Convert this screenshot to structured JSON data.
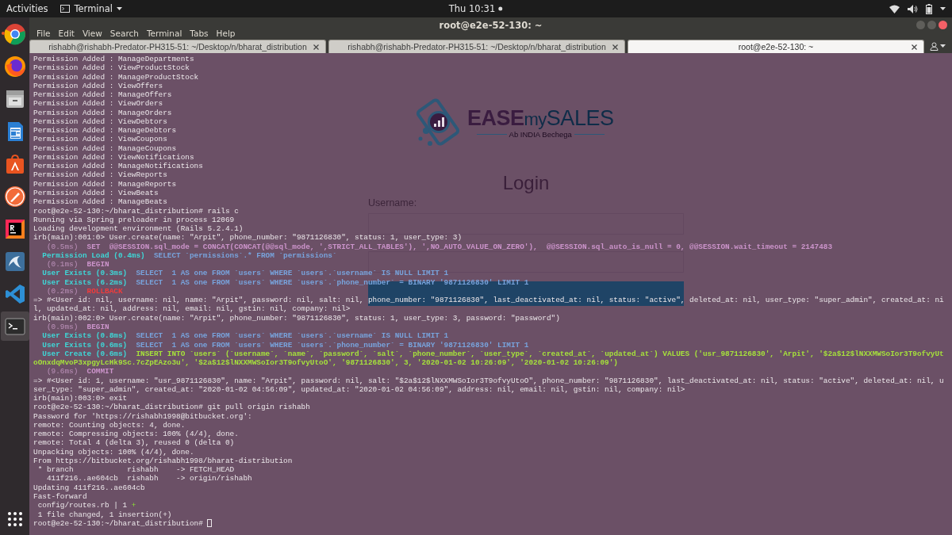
{
  "top_bar": {
    "activities": "Activities",
    "app_menu": "Terminal",
    "clock": "Thu 10:31"
  },
  "dock": [
    {
      "kind": "chrome",
      "running": true,
      "selected": false
    },
    {
      "kind": "firefox",
      "running": false,
      "selected": false
    },
    {
      "kind": "files",
      "running": false,
      "selected": false
    },
    {
      "kind": "writer",
      "running": false,
      "selected": false
    },
    {
      "kind": "software",
      "running": false,
      "selected": false
    },
    {
      "kind": "postman",
      "running": false,
      "selected": false
    },
    {
      "kind": "rubymine",
      "running": false,
      "selected": false
    },
    {
      "kind": "workbench",
      "running": false,
      "selected": false
    },
    {
      "kind": "vscode",
      "running": false,
      "selected": false
    },
    {
      "kind": "terminal",
      "running": false,
      "selected": true
    }
  ],
  "window": {
    "title": "root@e2e-52-130: ~",
    "menu": [
      "File",
      "Edit",
      "View",
      "Search",
      "Terminal",
      "Tabs",
      "Help"
    ],
    "tabs": [
      {
        "label": "rishabh@rishabh-Predator-PH315-51: ~/Desktop/n/bharat_distribution",
        "selected": false
      },
      {
        "label": "rishabh@rishabh-Predator-PH315-51: ~/Desktop/n/bharat_distribution",
        "selected": false
      },
      {
        "label": "root@e2e-52-130: ~",
        "selected": true
      }
    ]
  },
  "web_page": {
    "logo": {
      "part_1": "EASE",
      "part_2": "my",
      "part_3": "SALES",
      "tagline": "Ab INDIA Bechega"
    },
    "heading": "Login",
    "username_label": "Username:"
  },
  "terminal_lines": [
    {
      "spans": [
        {
          "kind": "plain",
          "text": "Permission Added : ManageDepartments"
        }
      ]
    },
    {
      "spans": [
        {
          "kind": "plain",
          "text": "Permission Added : ViewProductStock"
        }
      ]
    },
    {
      "spans": [
        {
          "kind": "plain",
          "text": "Permission Added : ManageProductStock"
        }
      ]
    },
    {
      "spans": [
        {
          "kind": "plain",
          "text": "Permission Added : ViewOffers"
        }
      ]
    },
    {
      "spans": [
        {
          "kind": "plain",
          "text": "Permission Added : ManageOffers"
        }
      ]
    },
    {
      "spans": [
        {
          "kind": "plain",
          "text": "Permission Added : ViewOrders"
        }
      ]
    },
    {
      "spans": [
        {
          "kind": "plain",
          "text": "Permission Added : ManageOrders"
        }
      ]
    },
    {
      "spans": [
        {
          "kind": "plain",
          "text": "Permission Added : ViewDebtors"
        }
      ]
    },
    {
      "spans": [
        {
          "kind": "plain",
          "text": "Permission Added : ManageDebtors"
        }
      ]
    },
    {
      "spans": [
        {
          "kind": "plain",
          "text": "Permission Added : ViewCoupons"
        }
      ]
    },
    {
      "spans": [
        {
          "kind": "plain",
          "text": "Permission Added : ManageCoupons"
        }
      ]
    },
    {
      "spans": [
        {
          "kind": "plain",
          "text": "Permission Added : ViewNotifications"
        }
      ]
    },
    {
      "spans": [
        {
          "kind": "plain",
          "text": "Permission Added : ManageNotifications"
        }
      ]
    },
    {
      "spans": [
        {
          "kind": "plain",
          "text": "Permission Added : ViewReports"
        }
      ]
    },
    {
      "spans": [
        {
          "kind": "plain",
          "text": "Permission Added : ManageReports"
        }
      ]
    },
    {
      "spans": [
        {
          "kind": "plain",
          "text": "Permission Added : ViewBeats"
        }
      ]
    },
    {
      "spans": [
        {
          "kind": "plain",
          "text": "Permission Added : ManageBeats"
        }
      ]
    },
    {
      "spans": [
        {
          "kind": "plain",
          "text": "root@e2e-52-130:~/bharat_distribution# rails c"
        }
      ]
    },
    {
      "spans": [
        {
          "kind": "plain",
          "text": "Running via Spring preloader in process 12069"
        }
      ]
    },
    {
      "spans": [
        {
          "kind": "plain",
          "text": "Loading development environment (Rails 5.2.4.1)"
        }
      ]
    },
    {
      "spans": [
        {
          "kind": "plain",
          "text": "irb(main):001:0> User.create(name: \"Arpit\", phone_number: \"9871126830\", status: 1, user_type: 3)"
        }
      ]
    },
    {
      "spans": [
        {
          "kind": "timing",
          "text": "   (0.5ms)"
        },
        {
          "kind": "tx",
          "text": "  SET  @@SESSION.sql_mode = CONCAT(CONCAT(@@sql_mode, ',STRICT_ALL_TABLES'), ',NO_AUTO_VALUE_ON_ZERO'),  @@SESSION.sql_auto_is_null = 0, @@SESSION.wait_timeout = 2147483"
        }
      ]
    },
    {
      "spans": [
        {
          "kind": "label",
          "text": "  Permission Load (0.4ms)"
        },
        {
          "kind": "sql",
          "text": "  SELECT `permissions`.* FROM `permissions`"
        }
      ]
    },
    {
      "spans": [
        {
          "kind": "timing",
          "text": "   (0.1ms)"
        },
        {
          "kind": "tx",
          "text": "  BEGIN"
        }
      ]
    },
    {
      "spans": [
        {
          "kind": "label",
          "text": "  User Exists (0.3ms)"
        },
        {
          "kind": "sql",
          "text": "  SELECT  1 AS one FROM `users` WHERE `users`.`username` IS NULL LIMIT 1"
        }
      ]
    },
    {
      "spans": [
        {
          "kind": "label",
          "text": "  User Exists (6.2ms)"
        },
        {
          "kind": "sql",
          "text": "  SELECT  1 AS one FROM `users` WHERE `users`.`phone_number` = BINARY '9871126830' LIMIT 1"
        }
      ]
    },
    {
      "spans": [
        {
          "kind": "timing",
          "text": "   (0.2ms)"
        },
        {
          "kind": "error",
          "text": "  ROLLBACK"
        }
      ]
    },
    {
      "spans": [
        {
          "kind": "plain",
          "text": "=> #<User id: nil, username: nil, name: \"Arpit\", password: nil, salt: nil, phone_number: \"9871126830\", last_deactivated_at: nil, status: \"active\", deleted_at: nil, user_type: \"super_admin\", created_at: ni"
        }
      ]
    },
    {
      "spans": [
        {
          "kind": "plain",
          "text": "l, updated_at: nil, address: nil, email: nil, gstin: nil, company: nil>"
        }
      ]
    },
    {
      "spans": [
        {
          "kind": "plain",
          "text": "irb(main):002:0> User.create(name: \"Arpit\", phone_number: \"9871126830\", status: 1, user_type: 3, password: \"password\")"
        }
      ]
    },
    {
      "spans": [
        {
          "kind": "timing",
          "text": "   (0.9ms)"
        },
        {
          "kind": "tx",
          "text": "  BEGIN"
        }
      ]
    },
    {
      "spans": [
        {
          "kind": "label",
          "text": "  User Exists (0.8ms)"
        },
        {
          "kind": "sql",
          "text": "  SELECT  1 AS one FROM `users` WHERE `users`.`username` IS NULL LIMIT 1"
        }
      ]
    },
    {
      "spans": [
        {
          "kind": "label",
          "text": "  User Exists (0.6ms)"
        },
        {
          "kind": "sql",
          "text": "  SELECT  1 AS one FROM `users` WHERE `users`.`phone_number` = BINARY '9871126830' LIMIT 1"
        }
      ]
    },
    {
      "spans": [
        {
          "kind": "label",
          "text": "  User Create (0.6ms)"
        },
        {
          "kind": "insert",
          "text": "  INSERT INTO `users` (`username`, `name`, `password`, `salt`, `phone_number`, `user_type`, `created_at`, `updated_at`) VALUES ('usr_9871126830', 'Arpit', '$2a$12$lNXXMWSoIor3T9ofvyUt"
        }
      ]
    },
    {
      "spans": [
        {
          "kind": "insert",
          "text": "oOnxdqMvoP3xpgyLcHk9Sc.7cZpEAzo3u', '$2a$12$lNXXMWSoIor3T9ofvyUtoO', '9871126830', 3, '2020-01-02 10:26:09', '2020-01-02 10:26:09')"
        }
      ]
    },
    {
      "spans": [
        {
          "kind": "timing",
          "text": "   (9.6ms)"
        },
        {
          "kind": "tx",
          "text": "  COMMIT"
        }
      ]
    },
    {
      "spans": [
        {
          "kind": "plain",
          "text": "=> #<User id: 1, username: \"usr_9871126830\", name: \"Arpit\", password: nil, salt: \"$2a$12$lNXXMWSoIor3T9ofvyUtoO\", phone_number: \"9871126830\", last_deactivated_at: nil, status: \"active\", deleted_at: nil, u"
        }
      ]
    },
    {
      "spans": [
        {
          "kind": "plain",
          "text": "ser_type: \"super_admin\", created_at: \"2020-01-02 04:56:09\", updated_at: \"2020-01-02 04:56:09\", address: nil, email: nil, gstin: nil, company: nil>"
        }
      ]
    },
    {
      "spans": [
        {
          "kind": "plain",
          "text": "irb(main):003:0> exit"
        }
      ]
    },
    {
      "spans": [
        {
          "kind": "plain",
          "text": "root@e2e-52-130:~/bharat_distribution# git pull origin rishabh"
        }
      ]
    },
    {
      "spans": [
        {
          "kind": "plain",
          "text": "Password for 'https://rishabh1998@bitbucket.org':"
        }
      ]
    },
    {
      "spans": [
        {
          "kind": "plain",
          "text": "remote: Counting objects: 4, done."
        }
      ]
    },
    {
      "spans": [
        {
          "kind": "plain",
          "text": "remote: Compressing objects: 100% (4/4), done."
        }
      ]
    },
    {
      "spans": [
        {
          "kind": "plain",
          "text": "remote: Total 4 (delta 3), reused 0 (delta 0)"
        }
      ]
    },
    {
      "spans": [
        {
          "kind": "plain",
          "text": "Unpacking objects: 100% (4/4), done."
        }
      ]
    },
    {
      "spans": [
        {
          "kind": "plain",
          "text": "From https://bitbucket.org/rishabh1998/bharat-distribution"
        }
      ]
    },
    {
      "spans": [
        {
          "kind": "plain",
          "text": " * branch            rishabh    -> FETCH_HEAD"
        }
      ]
    },
    {
      "spans": [
        {
          "kind": "plain",
          "text": "   411f216..ae604cb  rishabh    -> origin/rishabh"
        }
      ]
    },
    {
      "spans": [
        {
          "kind": "plain",
          "text": "Updating 411f216..ae604cb"
        }
      ]
    },
    {
      "spans": [
        {
          "kind": "plain",
          "text": "Fast-forward"
        }
      ]
    },
    {
      "spans": [
        {
          "kind": "plain",
          "text": " config/routes.rb | 1 "
        },
        {
          "kind": "added",
          "text": "+"
        }
      ]
    },
    {
      "spans": [
        {
          "kind": "plain",
          "text": " 1 file changed, 1 insertion(+)"
        }
      ]
    },
    {
      "spans": [
        {
          "kind": "plain",
          "text": "root@e2e-52-130:~/bharat_distribution# "
        }
      ],
      "cursor": true
    }
  ]
}
